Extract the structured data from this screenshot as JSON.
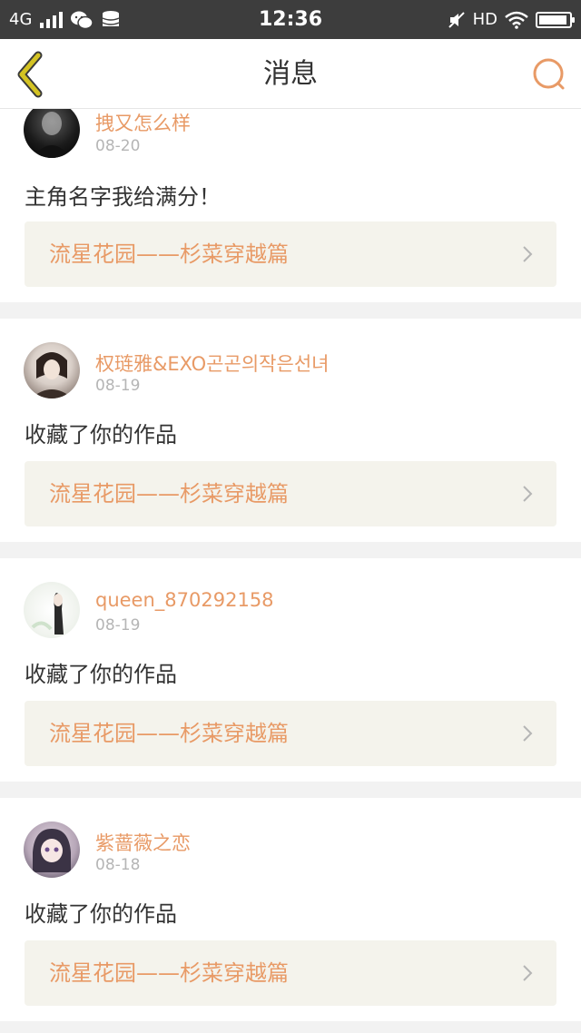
{
  "status_bar": {
    "network": "4G",
    "time": "12:36",
    "hd": "HD"
  },
  "nav": {
    "title": "消息",
    "back_icon": "chevron-left-icon",
    "search_icon": "search-icon"
  },
  "colors": {
    "accent": "#e89a66",
    "back_arrow": "#c9b91c",
    "card_bg": "#ffffff",
    "work_bg": "#f4f3ec",
    "page_bg": "#f2f2f2"
  },
  "messages": [
    {
      "user": "拽又怎么样",
      "date": "08-20",
      "text": "主角名字我给满分！",
      "work": "流星花园——杉菜穿越篇"
    },
    {
      "user": "权琏雅&EXO곤곤의작은선녀",
      "date": "08-19",
      "text": "收藏了你的作品",
      "work": "流星花园——杉菜穿越篇"
    },
    {
      "user": "queen_870292158",
      "date": "08-19",
      "text": "收藏了你的作品",
      "work": "流星花园——杉菜穿越篇"
    },
    {
      "user": "紫蔷薇之恋",
      "date": "08-18",
      "text": "收藏了你的作品",
      "work": "流星花园——杉菜穿越篇"
    }
  ]
}
